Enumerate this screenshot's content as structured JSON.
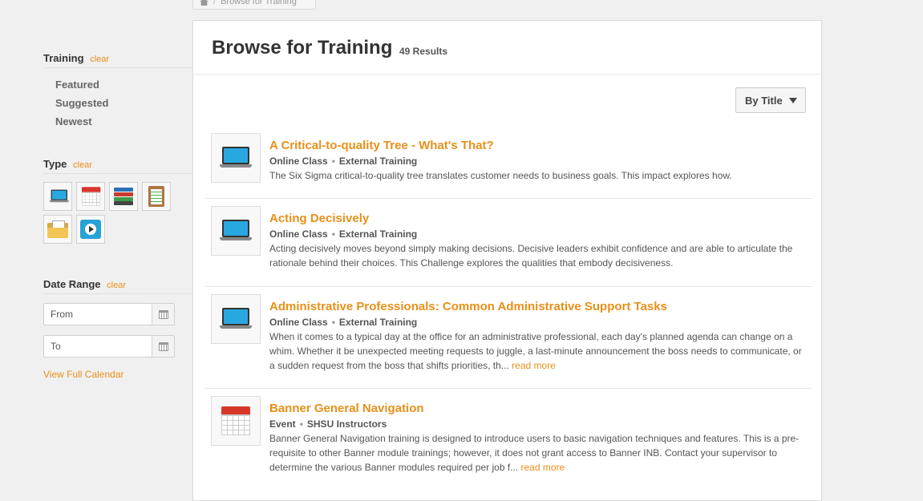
{
  "breadcrumb": {
    "current": "Browse for Training"
  },
  "sidebar": {
    "training": {
      "heading": "Training",
      "clear": "clear",
      "items": [
        "Featured",
        "Suggested",
        "Newest"
      ]
    },
    "type": {
      "heading": "Type",
      "clear": "clear",
      "icons": [
        "laptop-icon",
        "calendar-icon",
        "books-icon",
        "clipboard-icon",
        "folder-icon",
        "video-icon"
      ]
    },
    "date_range": {
      "heading": "Date Range",
      "clear": "clear",
      "from_placeholder": "From",
      "to_placeholder": "To",
      "view_calendar": "View Full Calendar"
    }
  },
  "main": {
    "title": "Browse for Training",
    "results_count": "49 Results",
    "sort_label": "By Title",
    "results": [
      {
        "icon": "laptop-icon",
        "title": "A Critical-to-quality Tree - What's That?",
        "type": "Online Class",
        "provider": "External Training",
        "description": "The Six Sigma critical-to-quality tree translates customer needs to business goals. This impact explores how.",
        "more": ""
      },
      {
        "icon": "laptop-icon",
        "title": "Acting Decisively",
        "type": "Online Class",
        "provider": "External Training",
        "description": "Acting decisively moves beyond simply making decisions. Decisive leaders exhibit confidence and are able to articulate the rationale behind their choices. This Challenge explores the qualities that embody decisiveness.",
        "more": ""
      },
      {
        "icon": "laptop-icon",
        "title": "Administrative Professionals: Common Administrative Support Tasks",
        "type": "Online Class",
        "provider": "External Training",
        "description": "When it comes to a typical day at the office for an administrative professional, each day's planned agenda can change on a whim. Whether it be unexpected meeting requests to juggle, a last-minute announcement the boss needs to communicate, or a sudden request from the boss that shifts priorities, th...",
        "more": "read more"
      },
      {
        "icon": "calendar-icon",
        "title": "Banner General Navigation",
        "type": "Event",
        "provider": "SHSU Instructors",
        "description": "Banner General Navigation training is designed to introduce users to basic navigation techniques and features. This is a pre-requisite to other Banner module trainings; however, it does not grant access to Banner INB. Contact your supervisor to determine the various Banner modules required per job f...",
        "more": "read more"
      }
    ]
  },
  "colors": {
    "accent": "#e8901a",
    "background": "#f0f0f0",
    "panel": "#ffffff",
    "screen_blue": "#29a8e0",
    "calendar_red": "#d8362a"
  }
}
